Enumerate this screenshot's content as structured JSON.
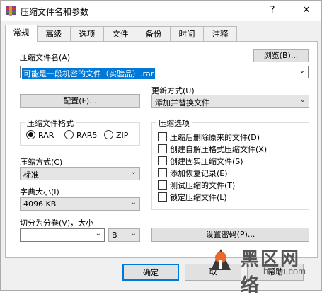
{
  "window": {
    "title": "压缩文件名和参数",
    "help_label": "?",
    "close_label": "✕"
  },
  "tabs": [
    {
      "label": "常规",
      "active": true
    },
    {
      "label": "高级"
    },
    {
      "label": "选项"
    },
    {
      "label": "文件"
    },
    {
      "label": "备份"
    },
    {
      "label": "时间"
    },
    {
      "label": "注释"
    }
  ],
  "general": {
    "archive_name_label": "压缩文件名(A)",
    "browse_button": "浏览(B)...",
    "archive_name_value": "可能是一段机密的文件（实验品）.rar",
    "profile_button": "配置(F)...",
    "update_mode_label": "更新方式(U)",
    "update_mode_value": "添加并替换文件",
    "format_group": {
      "title": "压缩文件格式",
      "options": [
        {
          "label": "RAR",
          "selected": true
        },
        {
          "label": "RAR5",
          "selected": false
        },
        {
          "label": "ZIP",
          "selected": false
        }
      ]
    },
    "options_group": {
      "title": "压缩选项",
      "items": [
        {
          "label": "压缩后删除原来的文件(D)",
          "checked": false
        },
        {
          "label": "创建自解压格式压缩文件(X)",
          "checked": false
        },
        {
          "label": "创建固实压缩文件(S)",
          "checked": false
        },
        {
          "label": "添加恢复记录(E)",
          "checked": false
        },
        {
          "label": "测试压缩的文件(T)",
          "checked": false
        },
        {
          "label": "锁定压缩文件(L)",
          "checked": false
        }
      ]
    },
    "method_label": "压缩方式(C)",
    "method_value": "标准",
    "dict_label": "字典大小(I)",
    "dict_value": "4096 KB",
    "split_label": "切分为分卷(V)，大小",
    "split_value": "",
    "split_unit": "B",
    "password_button": "设置密码(P)..."
  },
  "footer": {
    "ok_label": "确定",
    "cancel_label": "取",
    "help_label": "帮助"
  },
  "watermark": {
    "title": "黑区网络",
    "subtitle": "heiqu.com"
  },
  "colors": {
    "selection": "#0078d7",
    "dialog_bg": "#f0f0f0",
    "panel_bg": "#ffffff"
  }
}
